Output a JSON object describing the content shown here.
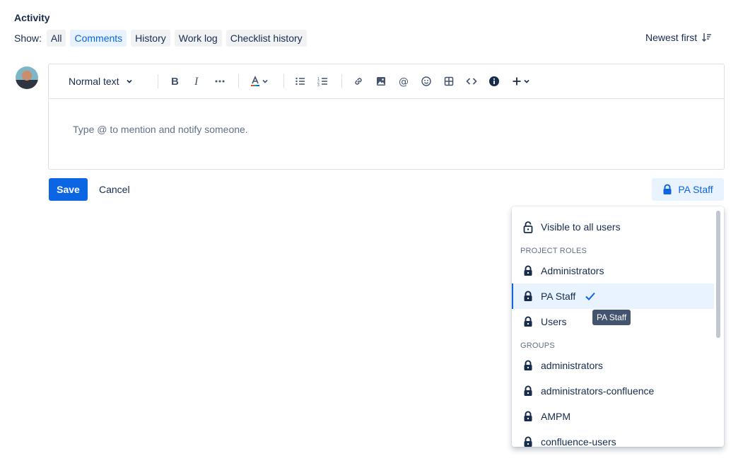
{
  "activity": {
    "title": "Activity",
    "show_label": "Show:",
    "filters": [
      "All",
      "Comments",
      "History",
      "Work log",
      "Checklist history"
    ],
    "active_filter": "Comments",
    "sort_label": "Newest first"
  },
  "editor": {
    "text_style": "Normal text",
    "placeholder": "Type @ to mention and notify someone.",
    "toolbar_icons": [
      "bold-icon",
      "italic-icon",
      "more-formatting-icon",
      "text-color-icon",
      "bullet-list-icon",
      "numbered-list-icon",
      "link-icon",
      "image-icon",
      "mention-icon",
      "emoji-icon",
      "table-icon",
      "code-icon",
      "info-panel-icon",
      "insert-plus-icon"
    ]
  },
  "actions": {
    "save_label": "Save",
    "cancel_label": "Cancel",
    "restriction_label": "PA Staff"
  },
  "visibility_dropdown": {
    "all_users_label": "Visible to all users",
    "project_roles_heading": "PROJECT ROLES",
    "roles": [
      "Administrators",
      "PA Staff",
      "Users"
    ],
    "selected_role": "PA Staff",
    "groups_heading": "GROUPS",
    "groups": [
      "administrators",
      "administrators-confluence",
      "AMPM",
      "confluence-users"
    ]
  },
  "tooltip": {
    "text": "PA Staff"
  },
  "colors": {
    "accent": "#0c66e4",
    "selected_bg": "#e9f2ff"
  }
}
